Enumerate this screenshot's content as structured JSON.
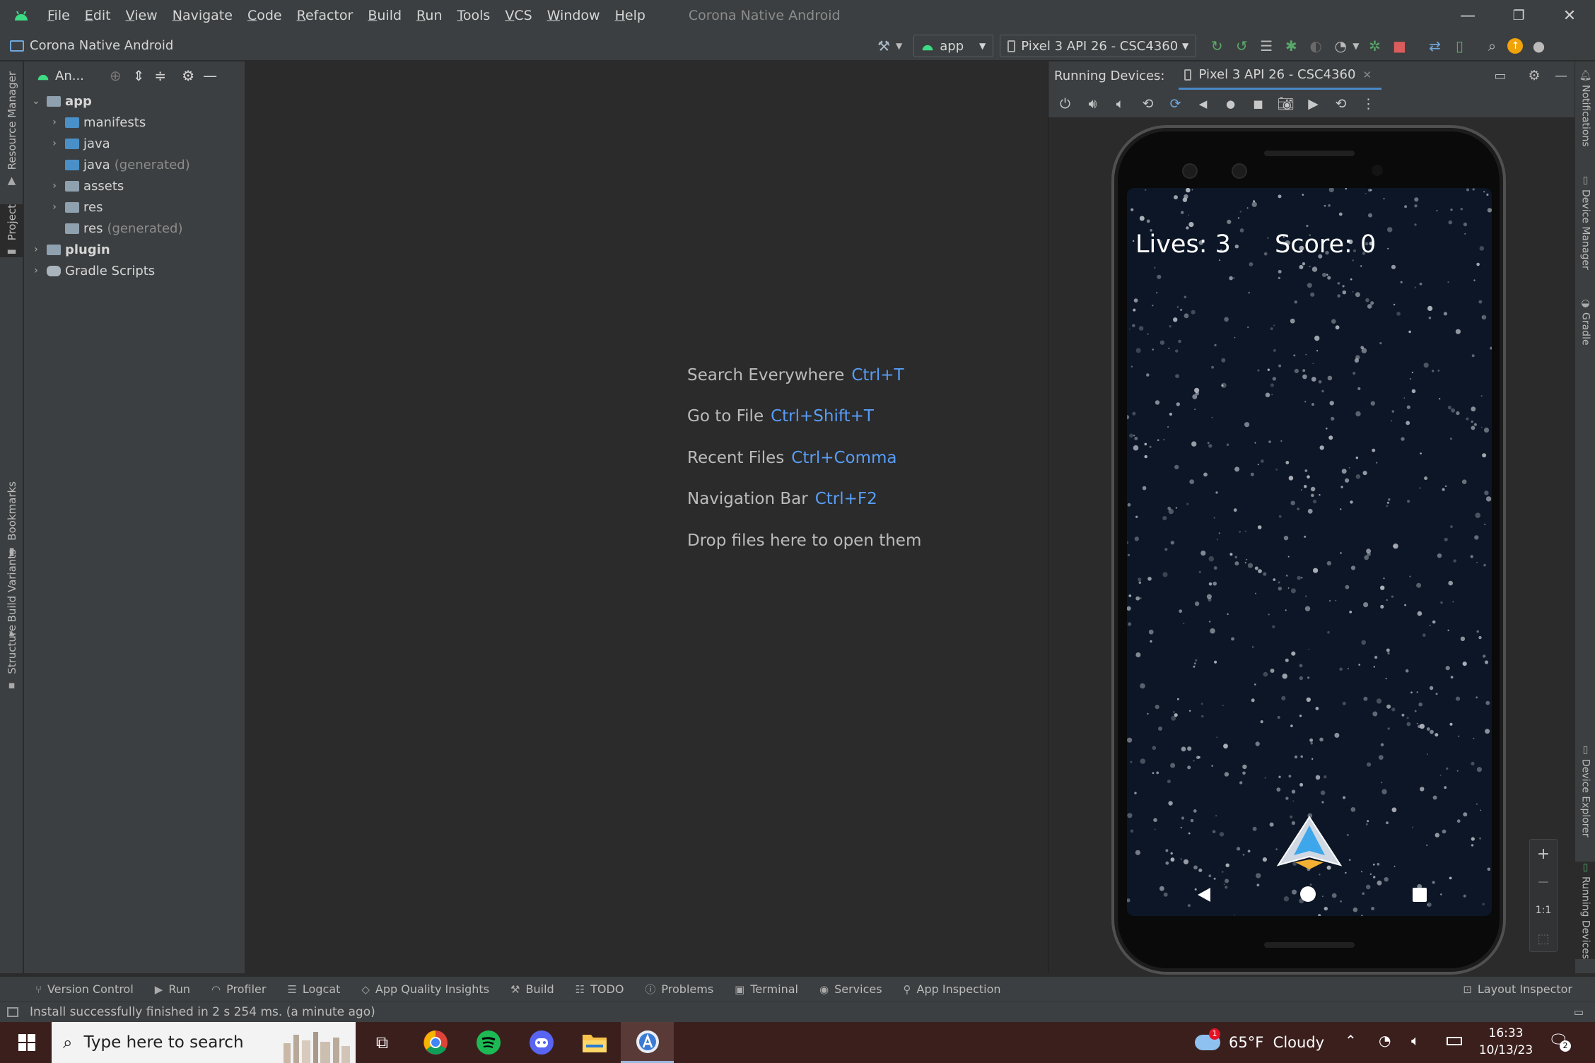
{
  "window": {
    "title": "Corona Native Android",
    "menu": [
      "File",
      "Edit",
      "View",
      "Navigate",
      "Code",
      "Refactor",
      "Build",
      "Run",
      "Tools",
      "VCS",
      "Window",
      "Help"
    ]
  },
  "toolbar": {
    "project_name": "Corona Native Android",
    "run_config": "app",
    "device": "Pixel 3 API 26 - CSC4360"
  },
  "left_tabs": [
    "Resource Manager",
    "Project",
    "Bookmarks",
    "Build Variants",
    "Structure"
  ],
  "right_tabs": [
    "Notifications",
    "Device Manager",
    "Gradle",
    "Device Explorer",
    "Running Devices"
  ],
  "project": {
    "view_label": "An...",
    "tree": [
      {
        "label": "app",
        "suffix": ""
      },
      {
        "label": "manifests",
        "suffix": ""
      },
      {
        "label": "java",
        "suffix": ""
      },
      {
        "label": "java",
        "suffix": "(generated)"
      },
      {
        "label": "assets",
        "suffix": ""
      },
      {
        "label": "res",
        "suffix": ""
      },
      {
        "label": "res",
        "suffix": "(generated)"
      },
      {
        "label": "plugin",
        "suffix": ""
      },
      {
        "label": "Gradle Scripts",
        "suffix": ""
      }
    ]
  },
  "editor_hints": [
    {
      "text": "Search Everywhere",
      "key": "Ctrl+T"
    },
    {
      "text": "Go to File",
      "key": "Ctrl+Shift+T"
    },
    {
      "text": "Recent Files",
      "key": "Ctrl+Comma"
    },
    {
      "text": "Navigation Bar",
      "key": "Ctrl+F2"
    },
    {
      "text": "Drop files here to open them",
      "key": ""
    }
  ],
  "devices": {
    "panel_label": "Running Devices:",
    "tab_label": "Pixel 3 API 26 - CSC4360"
  },
  "game": {
    "lives": "Lives: 3",
    "score": "Score: 0"
  },
  "zoom": {
    "plus": "+",
    "minus": "−",
    "one_to_one": "1:1"
  },
  "bottom_tabs": [
    "Version Control",
    "Run",
    "Profiler",
    "Logcat",
    "App Quality Insights",
    "Build",
    "TODO",
    "Problems",
    "Terminal",
    "Services",
    "App Inspection"
  ],
  "bottom_right_tab": "Layout Inspector",
  "status": {
    "message": "Install successfully finished in 2 s 254 ms. (a minute ago)"
  },
  "taskbar": {
    "search_placeholder": "Type here to search",
    "weather": "65°F  Cloudy",
    "time": "16:33",
    "date": "10/13/23",
    "notifications": "2",
    "weather_badge": "1"
  },
  "colors": {
    "accent_blue": "#589df6",
    "android_green": "#3ddc84",
    "game_bg": "#0c1626",
    "ide_bg": "#2b2b2b",
    "panel_bg": "#3c3f41"
  }
}
